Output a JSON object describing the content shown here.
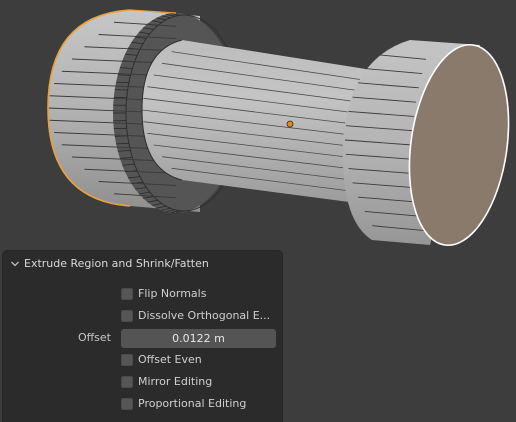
{
  "panel": {
    "title": "Extrude Region and Shrink/Fatten",
    "expanded": true,
    "options": [
      {
        "label": "Flip Normals",
        "checked": false
      },
      {
        "label": "Dissolve Orthogonal E...",
        "checked": false
      }
    ],
    "offset": {
      "label": "Offset",
      "value": "0.0122 m"
    },
    "options2": [
      {
        "label": "Offset Even",
        "checked": false
      },
      {
        "label": "Mirror Editing",
        "checked": false
      },
      {
        "label": "Proportional Editing",
        "checked": false
      }
    ]
  },
  "viewport": {
    "background_color": "#3d3d3d",
    "mesh_color": "#b4b4b4",
    "selected_face_color": "#8a7a6c",
    "selection_outline_color": "#ffffff",
    "active_outline_color": "#e8a23c",
    "origin_color": "#e9861a"
  }
}
